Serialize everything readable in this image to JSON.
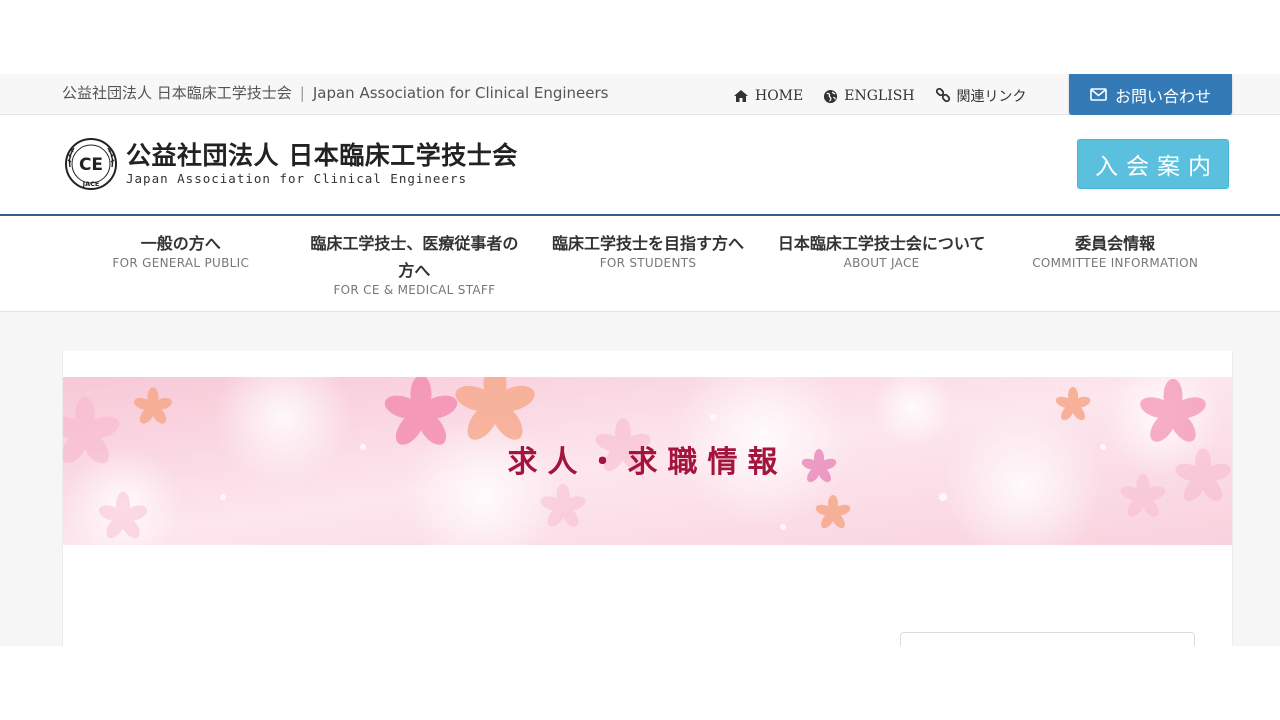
{
  "topbar": {
    "org_jp": "公益社団法人 日本臨床工学技士会",
    "separator": "|",
    "org_en": "Japan Association for Clinical Engineers",
    "links": [
      {
        "label": "HOME",
        "icon": "home-icon"
      },
      {
        "label": "ENGLISH",
        "icon": "globe-icon"
      },
      {
        "label": "関連リンク",
        "icon": "link-icon"
      }
    ],
    "contact_label": "お問い合わせ",
    "contact_icon": "envelope-icon"
  },
  "header": {
    "logo_mark_text": "CE",
    "logo_mark_sub": "JACE",
    "logo_jp": "公益社団法人 日本臨床工学技士会",
    "logo_en": "Japan Association for Clinical Engineers",
    "join_label": "入会案内"
  },
  "nav": {
    "items": [
      {
        "jp": "一般の方へ",
        "en": "FOR GENERAL PUBLIC"
      },
      {
        "jp": "臨床工学技士、医療従事者の方へ",
        "en": "FOR CE & MEDICAL STAFF"
      },
      {
        "jp": "臨床工学技士を目指す方へ",
        "en": "FOR STUDENTS"
      },
      {
        "jp": "日本臨床工学技士会について",
        "en": "ABOUT JACE"
      },
      {
        "jp": "委員会情報",
        "en": "COMMITTEE INFORMATION"
      }
    ]
  },
  "banner": {
    "title": "求人・求職情報"
  },
  "colors": {
    "primary": "#337ab7",
    "info": "#5bc0de",
    "banner_title": "#a4143c",
    "nav_border": "#2c5f8d"
  }
}
